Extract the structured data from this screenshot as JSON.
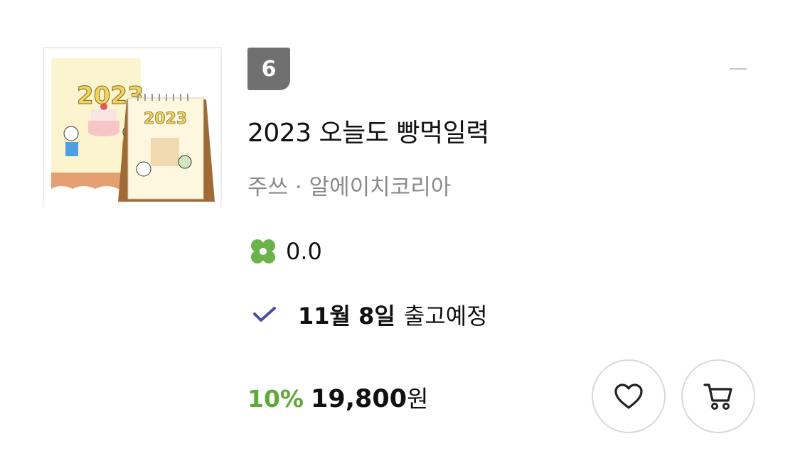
{
  "product": {
    "rank": "6",
    "title": "2023 오늘도 빵먹일력",
    "author": "주쓰",
    "separator": "·",
    "publisher": "알에이치코리아",
    "rating": "0.0",
    "delivery": {
      "date": "11월 8일",
      "status": "출고예정"
    },
    "price": {
      "discount": "10%",
      "amount": "19,800",
      "unit": "원"
    },
    "cover_text": "2023"
  },
  "icons": {
    "rating": "clover-icon",
    "delivery": "check-icon",
    "wishlist": "heart-icon",
    "cart": "cart-icon",
    "collapse": "minus-icon"
  },
  "colors": {
    "rank_badge": "#707070",
    "discount": "#5fa83a",
    "clover": "#6cb24a",
    "check": "#4a4f9e",
    "meta_text": "#8a8a8a"
  }
}
